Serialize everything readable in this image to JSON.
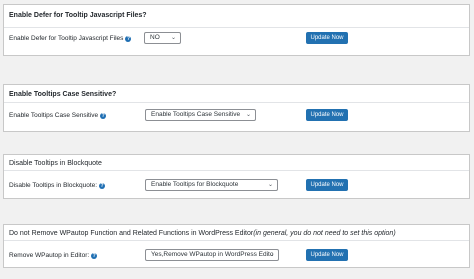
{
  "sections": [
    {
      "title": "Enable Defer for Tooltip Javascript Files?",
      "label": "Enable Defer for Tooltip Javascript Files",
      "help_icon": "?",
      "select_value": "NO",
      "button": "Update Now"
    },
    {
      "title": "Enable Tooltips Case Sensitive?",
      "label": "Enable Tooltips Case Sensitive",
      "help_icon": "?",
      "select_value": "Enable Tooltips Case Sensitive",
      "button": "Update Now"
    },
    {
      "title": "Disable Tooltips in Blockquote",
      "label": "Disable Tooltips in Blockquote:",
      "help_icon": "?",
      "select_value": "Enable Tooltips for Blockquote",
      "button": "Update Now"
    },
    {
      "title": "Do not Remove WPautop Function and Related Functions in WordPress Editor",
      "title_note": "(in general, you do not need to set this option)",
      "label": "Remove WPautop in Editor:",
      "help_icon": "?",
      "select_value": "Yes,Remove WPautop in WordPress Edito",
      "button": "Update Now"
    }
  ],
  "colors": {
    "button_bg": "#2271b1",
    "help_icon": "#1f6fb3",
    "page_bg": "#f1f1f1",
    "panel_bg": "#ffffff"
  }
}
